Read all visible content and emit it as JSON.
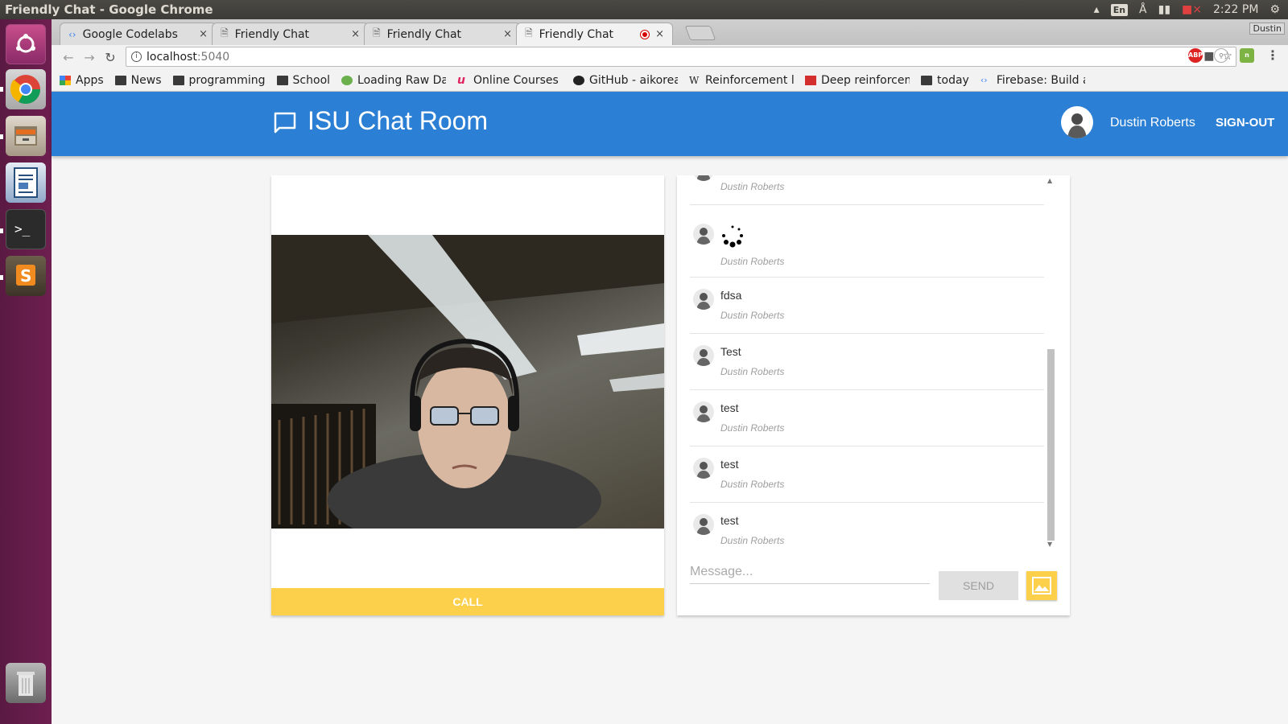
{
  "window": {
    "title": "Friendly Chat - Google Chrome"
  },
  "tray": {
    "lang": "En",
    "clock": "2:22 PM"
  },
  "tabs": [
    {
      "label": "Google Codelabs",
      "close": "×"
    },
    {
      "label": "Friendly Chat",
      "close": "×"
    },
    {
      "label": "Friendly Chat",
      "close": "×"
    },
    {
      "label": "Friendly Chat",
      "close": "×",
      "active": true,
      "recording": true
    }
  ],
  "profile": {
    "name": "Dustin"
  },
  "address": {
    "host": "localhost",
    "port": ":5040"
  },
  "bookmarks": [
    {
      "label": "Apps",
      "icon": "apps-grid-icon"
    },
    {
      "label": "News",
      "icon": "folder-icon"
    },
    {
      "label": "programming",
      "icon": "folder-icon"
    },
    {
      "label": "School",
      "icon": "folder-icon"
    },
    {
      "label": "Loading Raw Da",
      "icon": "page-favicon"
    },
    {
      "label": "Online Courses -",
      "icon": "udemy-icon"
    },
    {
      "label": "GitHub - aikorea",
      "icon": "github-icon"
    },
    {
      "label": "Reinforcement l",
      "icon": "wikipedia-icon"
    },
    {
      "label": "Deep reinforcem",
      "icon": "page-favicon"
    },
    {
      "label": "today",
      "icon": "folder-icon"
    },
    {
      "label": "Firebase: Build a",
      "icon": "codelabs-icon"
    }
  ],
  "app": {
    "title": "ISU Chat Room",
    "user_name": "Dustin Roberts",
    "signout_label": "SIGN-OUT",
    "brand_color": "#2b7fd4",
    "accent_color": "#fdd04b"
  },
  "video": {
    "call_label": "CALL"
  },
  "chat": {
    "messages": [
      {
        "text": "fdsa",
        "author": "Dustin Roberts"
      },
      {
        "text": "",
        "author": "Dustin Roberts",
        "loading": true
      },
      {
        "text": "fdsa",
        "author": "Dustin Roberts"
      },
      {
        "text": "Test",
        "author": "Dustin Roberts"
      },
      {
        "text": "test",
        "author": "Dustin Roberts"
      },
      {
        "text": "test",
        "author": "Dustin Roberts"
      },
      {
        "text": "test",
        "author": "Dustin Roberts"
      }
    ],
    "placeholder": "Message...",
    "send_label": "SEND"
  }
}
